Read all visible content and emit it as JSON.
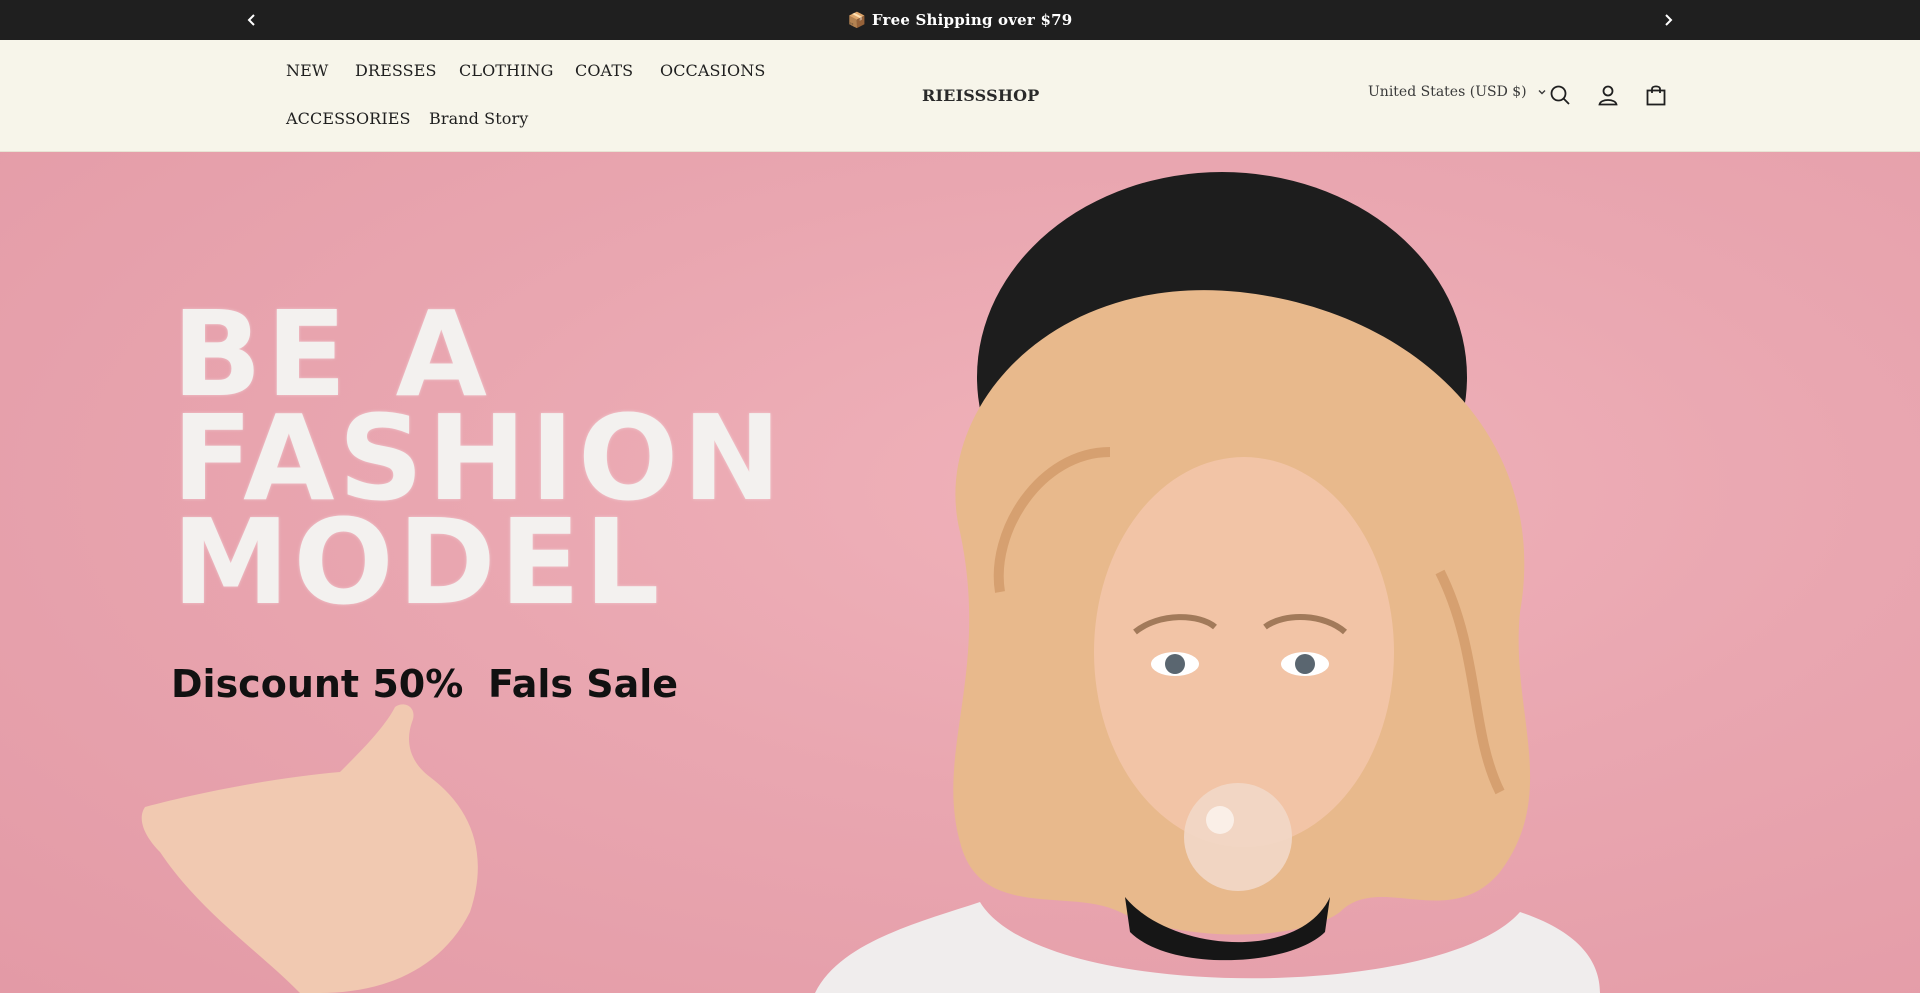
{
  "announcement": {
    "text": "📦 Free Shipping over $79",
    "prev_icon": "chevron-left-icon",
    "next_icon": "chevron-right-icon"
  },
  "header": {
    "nav": [
      {
        "label": "NEW"
      },
      {
        "label": "DRESSES"
      },
      {
        "label": "CLOTHING"
      },
      {
        "label": "COATS"
      },
      {
        "label": "OCCASIONS"
      },
      {
        "label": "ACCESSORIES"
      },
      {
        "label": "Brand Story"
      }
    ],
    "logo": "RIEISSSHOP",
    "country_selector": "United States (USD $)",
    "icons": [
      "search-icon",
      "account-icon",
      "cart-icon"
    ]
  },
  "hero": {
    "title_lines": [
      "BE A",
      "FASHION",
      "MODEL"
    ],
    "discount": "Discount 50%",
    "sale": "Fals Sale"
  },
  "colors": {
    "announcement_bg": "#1f1f1f",
    "header_bg": "#f7f5ea",
    "hero_bg": "#eaa8b2",
    "text": "#1f1f1f"
  }
}
